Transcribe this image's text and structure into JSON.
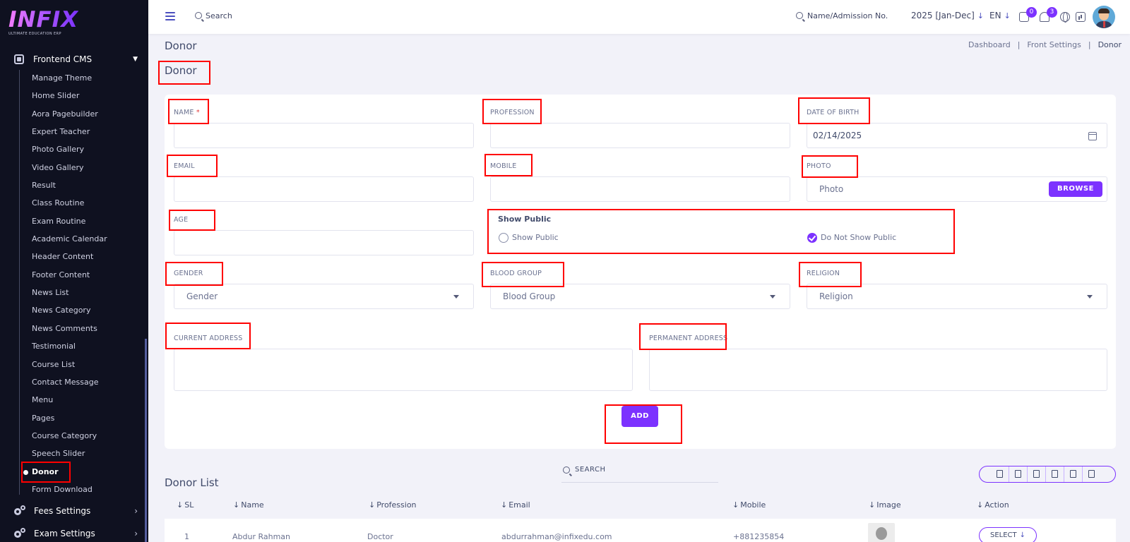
{
  "brand": {
    "logo": "INFIX",
    "tagline": "ULTIMATE EDUCATION ERP"
  },
  "sidebar": {
    "section": "Frontend CMS",
    "items": [
      "Manage Theme",
      "Home Slider",
      "Aora Pagebuilder",
      "Expert Teacher",
      "Photo Gallery",
      "Video Gallery",
      "Result",
      "Class Routine",
      "Exam Routine",
      "Academic Calendar",
      "Header Content",
      "Footer Content",
      "News List",
      "News Category",
      "News Comments",
      "Testimonial",
      "Course List",
      "Contact Message",
      "Menu",
      "Pages",
      "Course Category",
      "Speech Slider",
      "Donor",
      "Form Download"
    ],
    "active_item": "Donor",
    "fees_settings": "Fees Settings",
    "exam_settings": "Exam Settings"
  },
  "topbar": {
    "search_label": "Search",
    "admission_search": "Name/Admission No.",
    "session": "2025 [Jan-Dec]",
    "language": "EN",
    "chat_badge": "0",
    "notification_badge": "3"
  },
  "page": {
    "heading": "Donor",
    "breadcrumb": [
      "Dashboard",
      "Front Settings",
      "Donor"
    ],
    "form_title": "Donor"
  },
  "form": {
    "name_label": "NAME",
    "required_mark": "*",
    "profession_label": "PROFESSION",
    "dob_label": "DATE OF BIRTH",
    "dob_value": "02/14/2025",
    "email_label": "EMAIL",
    "mobile_label": "MOBILE",
    "photo_label": "PHOTO",
    "photo_placeholder": "Photo",
    "browse_label": "BROWSE",
    "age_label": "AGE",
    "show_public_title": "Show Public",
    "show_public_option": "Show Public",
    "hide_public_option": "Do Not Show Public",
    "gender_label": "GENDER",
    "gender_placeholder": "Gender",
    "blood_group_label": "BLOOD GROUP",
    "blood_group_placeholder": "Blood Group",
    "religion_label": "RELIGION",
    "religion_placeholder": "Religion",
    "current_address_label": "CURRENT ADDRESS",
    "permanent_address_label": "PERMANENT ADDRESS",
    "add_label": "ADD"
  },
  "list": {
    "title": "Donor List",
    "search_label": "SEARCH",
    "columns": [
      "SL",
      "Name",
      "Profession",
      "Email",
      "Mobile",
      "Image",
      "Action"
    ],
    "rows": [
      {
        "sl": "1",
        "name": "Abdur Rahman",
        "profession": "Doctor",
        "email": "abdurrahman@infixedu.com",
        "mobile": "+881235854",
        "action": "SELECT"
      }
    ]
  },
  "colors": {
    "accent": "#7c32ff",
    "sidebar_bg": "#0f1120",
    "highlight": "#ff0000"
  }
}
